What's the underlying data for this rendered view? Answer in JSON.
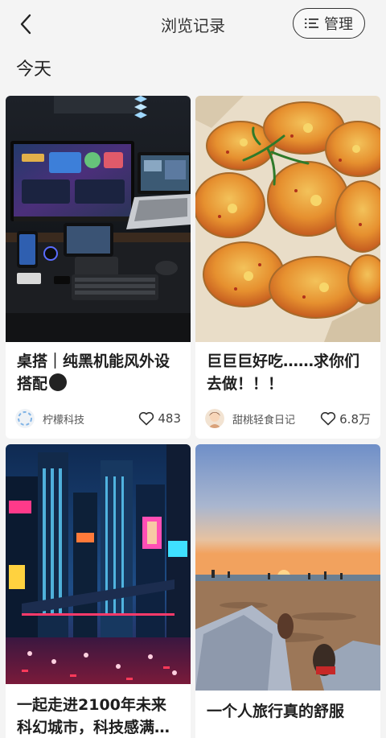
{
  "header": {
    "title": "浏览记录",
    "manage_label": "管理"
  },
  "section_title": "今天",
  "cards": [
    {
      "title": "桌搭｜纯黑机能风外设搭配",
      "author": "柠檬科技",
      "likes": "483",
      "image": "dark-desk-setup-photo"
    },
    {
      "title": "巨巨巨好吃……求你们去做！！！",
      "author": "甜桃轻食日记",
      "likes": "6.8万",
      "image": "shrimp-toast-photo"
    },
    {
      "title": "一起走进2100年未来科幻城市，科技感满…",
      "image": "cyberpunk-city-photo"
    },
    {
      "title": "一个人旅行真的舒服",
      "image": "beach-sunset-photo"
    }
  ]
}
